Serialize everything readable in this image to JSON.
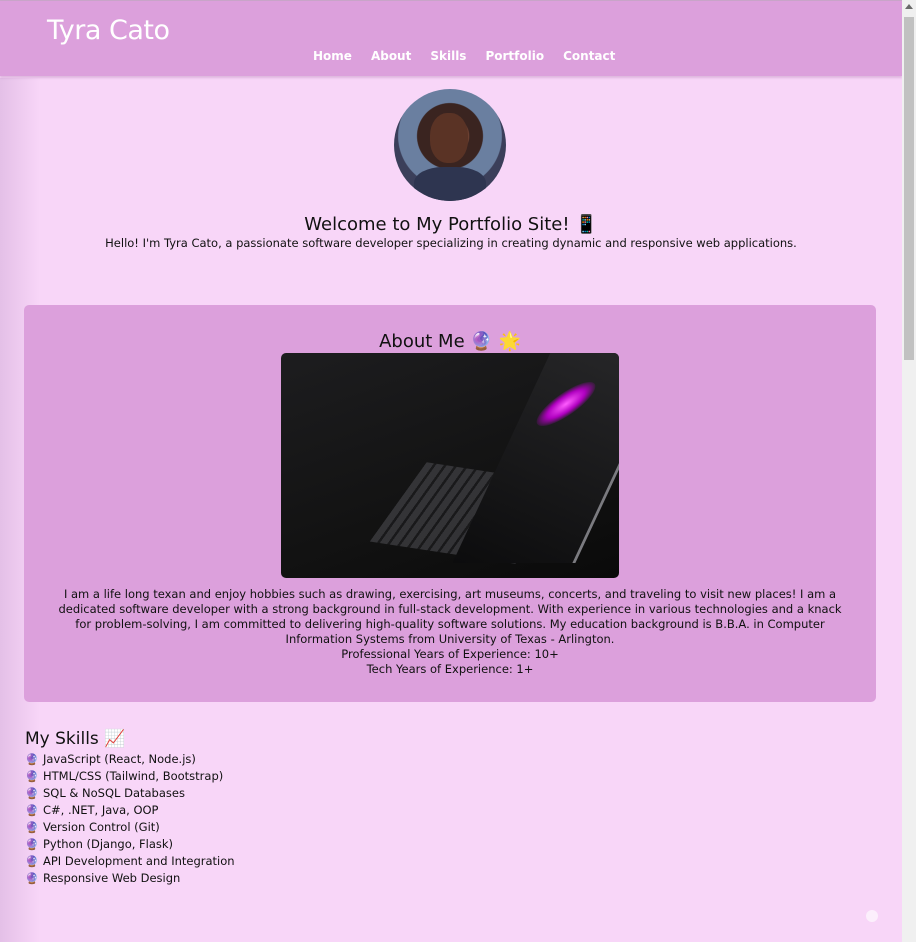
{
  "header": {
    "brand": "Tyra Cato",
    "nav": [
      "Home",
      "About",
      "Skills",
      "Portfolio",
      "Contact"
    ]
  },
  "hero": {
    "title": "Welcome to My Portfolio Site! 📱",
    "intro": "Hello! I'm Tyra Cato, a passionate software developer specializing in creating dynamic and responsive web applications."
  },
  "about": {
    "title": "About Me 🔮 🌟",
    "paragraph": "I am a life long texan and enjoy hobbies such as drawing, exercising, art museums, concerts, and traveling to visit new places! I am a dedicated software developer with a strong background in full-stack development. With experience in various technologies and a knack for problem-solving, I am committed to delivering high-quality software solutions. My education background is B.B.A. in Computer Information Systems from University of Texas - Arlington.",
    "professional_years": "Professional Years of Experience: 10+",
    "tech_years": "Tech Years of Experience: 1+"
  },
  "skills": {
    "title": "My Skills 📈",
    "bullet": "🔮",
    "items": [
      "JavaScript (React, Node.js)",
      "HTML/CSS (Tailwind, Bootstrap)",
      "SQL & NoSQL Databases",
      "C#, .NET, Java, OOP",
      "Version Control (Git)",
      "Python (Django, Flask)",
      "API Development and Integration",
      "Responsive Web Design"
    ]
  }
}
